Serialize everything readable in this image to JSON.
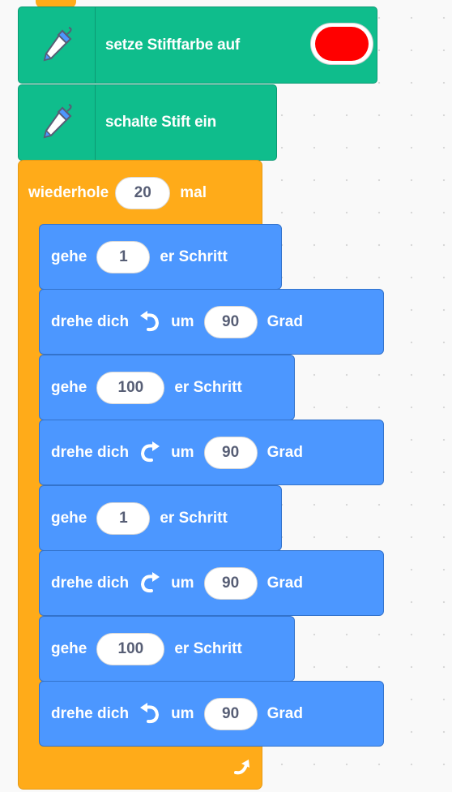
{
  "pen_blocks": {
    "set_color": {
      "label": "setze Stiftfarbe auf",
      "color": "#ff0000"
    },
    "pen_down": {
      "label": "schalte Stift ein"
    }
  },
  "loop": {
    "label_before": "wiederhole",
    "count": "20",
    "label_after": "mal",
    "accent": "#ffab19"
  },
  "motion": {
    "accent": "#4c97ff",
    "blocks": [
      {
        "type": "move",
        "verb": "gehe",
        "value": "1",
        "suffix": "er Schritt"
      },
      {
        "type": "turn",
        "verb": "drehe dich",
        "direction": "left",
        "icon": "rotate-left-icon",
        "mid": "um",
        "value": "90",
        "suffix": "Grad"
      },
      {
        "type": "move",
        "verb": "gehe",
        "value": "100",
        "suffix": "er Schritt"
      },
      {
        "type": "turn",
        "verb": "drehe dich",
        "direction": "right",
        "icon": "rotate-right-icon",
        "mid": "um",
        "value": "90",
        "suffix": "Grad"
      },
      {
        "type": "move",
        "verb": "gehe",
        "value": "1",
        "suffix": "er Schritt"
      },
      {
        "type": "turn",
        "verb": "drehe dich",
        "direction": "right",
        "icon": "rotate-right-icon",
        "mid": "um",
        "value": "90",
        "suffix": "Grad"
      },
      {
        "type": "move",
        "verb": "gehe",
        "value": "100",
        "suffix": "er Schritt"
      },
      {
        "type": "turn",
        "verb": "drehe dich",
        "direction": "left",
        "icon": "rotate-left-icon",
        "mid": "um",
        "value": "90",
        "suffix": "Grad"
      }
    ]
  }
}
